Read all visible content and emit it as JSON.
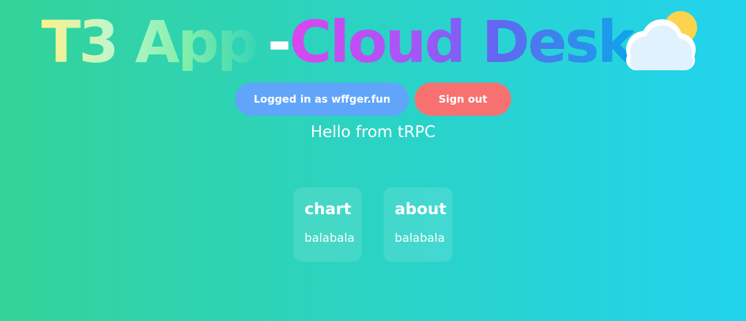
{
  "header": {
    "title_part1": "T3 App",
    "title_dash": "-",
    "title_part2": "Cloud Desk",
    "logo_icon": "cloud-sun-icon"
  },
  "auth": {
    "status_label": "Logged in as wffger.fun",
    "signout_label": "Sign out"
  },
  "greeting": "Hello from tRPC",
  "cards": [
    {
      "title": "chart",
      "body": "balabala"
    },
    {
      "title": "about",
      "body": "balabala"
    }
  ],
  "colors": {
    "background_start": "#34d399",
    "background_end": "#22d3ee",
    "login_button": "#60a5fa",
    "signout_button": "#f87171",
    "sun": "#fcd34d",
    "cloud": "#e0f2fe"
  }
}
